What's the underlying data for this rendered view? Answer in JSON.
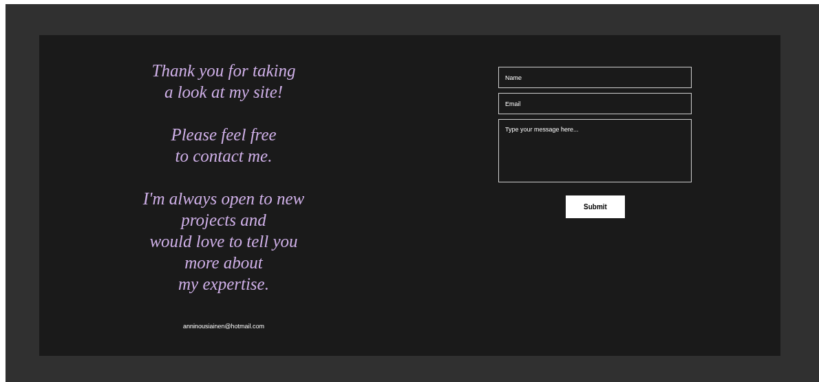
{
  "message": {
    "paragraphs": [
      {
        "lines": [
          "Thank you for taking",
          "a look at my site!"
        ]
      },
      {
        "lines": [
          "Please feel free",
          "to contact me."
        ]
      },
      {
        "lines": [
          "I'm always open to new",
          "projects and",
          "would love to tell you",
          "more about",
          "my expertise."
        ]
      }
    ],
    "email": "anninousiainen@hotmail.com"
  },
  "form": {
    "fields": [
      {
        "kind": "input",
        "placeholder": "Name"
      },
      {
        "kind": "input",
        "placeholder": "Email"
      },
      {
        "kind": "textarea",
        "placeholder": "Type your message here..."
      }
    ],
    "submit": "Submit"
  }
}
